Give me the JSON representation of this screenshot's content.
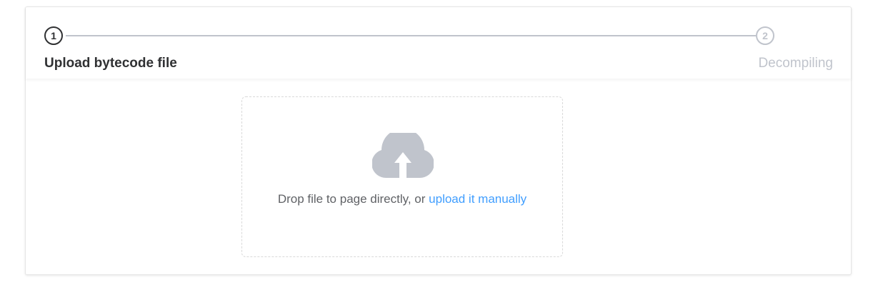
{
  "steps": [
    {
      "number": "1",
      "title": "Upload bytecode file",
      "status": "active"
    },
    {
      "number": "2",
      "title": "Decompiling",
      "status": "inactive"
    }
  ],
  "upload": {
    "icon": "cloud-upload-icon",
    "text_prefix": "Drop file to page directly, or ",
    "link_label": "upload it manually"
  },
  "colors": {
    "active": "#303133",
    "inactive": "#c0c4cc",
    "link": "#409eff",
    "icon": "#c0c4cc"
  }
}
